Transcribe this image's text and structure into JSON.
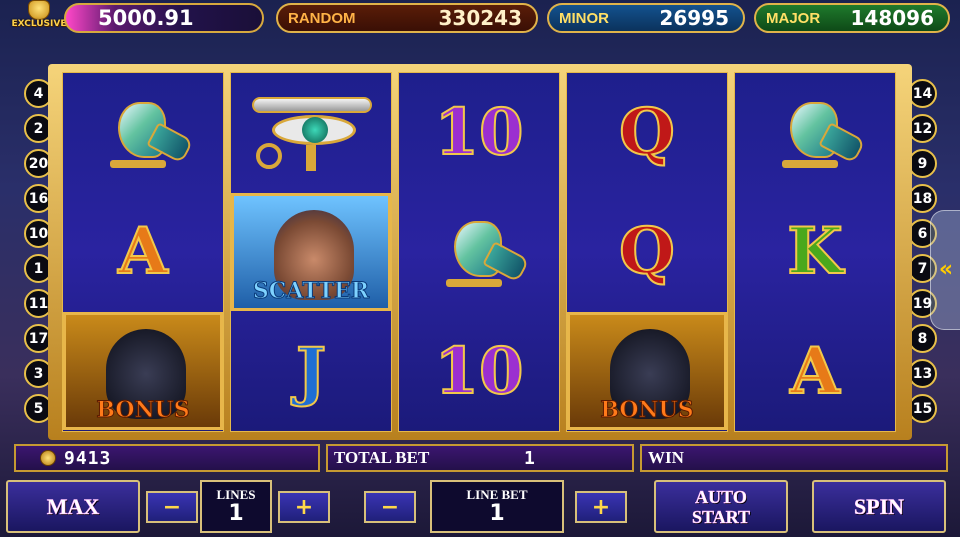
{
  "header": {
    "exclusive_label": "EXCLUSIVE",
    "balance": "5000.91",
    "jackpots": [
      {
        "label": "RANDOM",
        "value": "330243"
      },
      {
        "label": "MINOR",
        "value": "26995"
      },
      {
        "label": "MAJOR",
        "value": "148096"
      }
    ]
  },
  "paylines": {
    "left": [
      "4",
      "2",
      "20",
      "16",
      "10",
      "1",
      "11",
      "17",
      "3",
      "5"
    ],
    "right": [
      "14",
      "12",
      "9",
      "18",
      "6",
      "7",
      "19",
      "8",
      "13",
      "15"
    ]
  },
  "reels": [
    [
      {
        "symbol": "falcon-icon"
      },
      {
        "text": "A",
        "color": "orange"
      },
      {
        "special": "bonus",
        "text": "BONUS"
      }
    ],
    [
      {
        "symbol": "eye-of-horus-icon"
      },
      {
        "special": "scatter",
        "text": "SCATTER"
      },
      {
        "text": "J",
        "color": "blue"
      }
    ],
    [
      {
        "text": "10",
        "color": "purple"
      },
      {
        "symbol": "falcon-icon"
      },
      {
        "text": "10",
        "color": "purple"
      }
    ],
    [
      {
        "text": "Q",
        "color": "red"
      },
      {
        "text": "Q",
        "color": "red"
      },
      {
        "special": "bonus",
        "text": "BONUS"
      }
    ],
    [
      {
        "symbol": "falcon-icon"
      },
      {
        "text": "K",
        "color": "green"
      },
      {
        "text": "A",
        "color": "orange"
      }
    ]
  ],
  "info": {
    "credits": "9413",
    "total_bet_label": "TOTAL BET",
    "total_bet": "1",
    "win_label": "WIN",
    "win": ""
  },
  "controls": {
    "max_label": "MAX",
    "minus": "−",
    "plus": "+",
    "lines_label": "LINES",
    "lines_value": "1",
    "line_bet_label": "LINE BET",
    "line_bet_value": "1",
    "auto_label_1": "AUTO",
    "auto_label_2": "START",
    "spin_label": "SPIN",
    "side_arrow": "«"
  }
}
